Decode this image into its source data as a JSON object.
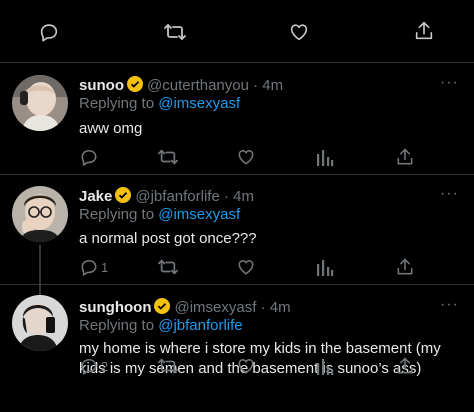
{
  "colors": {
    "background": "#000000",
    "text": "#e7e9ea",
    "muted": "#71767b",
    "link": "#1d9bf0",
    "verified": "#f4c20d",
    "divider": "#2f3336"
  },
  "top_actions": {
    "icons": [
      "reply-icon",
      "retweet-icon",
      "like-icon",
      "share-icon"
    ]
  },
  "tweets": [
    {
      "name": "sunoo",
      "handle": "@cuterthanyou",
      "dot": "·",
      "time": "4m",
      "more": "···",
      "reply_prefix": "Replying to",
      "reply_to": "@imsexyasf",
      "text": "aww omg",
      "reply_count": "",
      "icons": [
        "reply-icon",
        "retweet-icon",
        "like-icon",
        "analytics-icon",
        "share-icon"
      ]
    },
    {
      "name": "Jake",
      "handle": "@jbfanforlife",
      "dot": "·",
      "time": "4m",
      "more": "···",
      "reply_prefix": "Replying to",
      "reply_to": "@imsexyasf",
      "text": "a normal post got once???",
      "reply_count": "1",
      "icons": [
        "reply-icon",
        "retweet-icon",
        "like-icon",
        "analytics-icon",
        "share-icon"
      ]
    },
    {
      "name": "sunghoon",
      "handle": "@imsexyasf",
      "dot": "·",
      "time": "4m",
      "more": "···",
      "reply_prefix": "Replying to",
      "reply_to": "@jbfanforlife",
      "text": "my home is where i store my kids in the basement (my kids is my semen and the basement is sunoo’s ass)",
      "reply_count": "2",
      "icons": [
        "reply-icon",
        "retweet-icon",
        "like-icon",
        "analytics-icon",
        "share-icon"
      ]
    }
  ]
}
